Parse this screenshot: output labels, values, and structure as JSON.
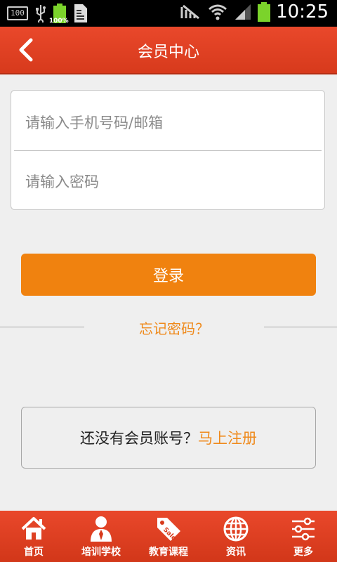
{
  "status_bar": {
    "notif_box": "100",
    "battery_small_label": "100%",
    "time": "10:25"
  },
  "header": {
    "title": "会员中心"
  },
  "login": {
    "account_placeholder": "请输入手机号码/邮箱",
    "password_placeholder": "请输入密码",
    "login_label": "登录",
    "forgot_label": "忘记密码？"
  },
  "register": {
    "prompt": "还没有会员账号？",
    "link": "马上注册"
  },
  "bottom_nav": {
    "items": [
      {
        "label": "首页",
        "icon": "home-icon"
      },
      {
        "label": "培训学校",
        "icon": "person-tie-icon"
      },
      {
        "label": "教育课程",
        "icon": "sale-tag-icon"
      },
      {
        "label": "资讯",
        "icon": "globe-icon"
      },
      {
        "label": "更多",
        "icon": "sliders-icon"
      }
    ]
  },
  "colors": {
    "header": "#e9482b",
    "accent": "#f0820f",
    "link": "#ef8a1c"
  }
}
